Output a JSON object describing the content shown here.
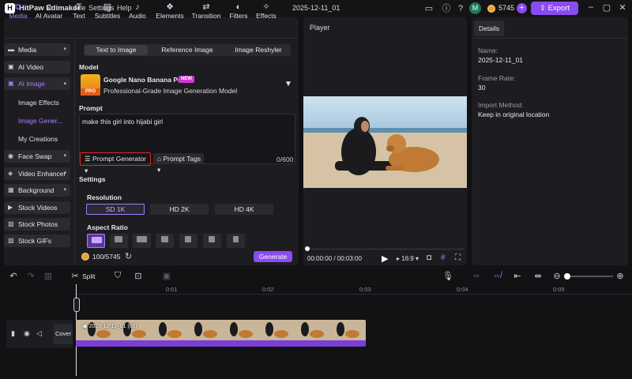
{
  "titlebar": {
    "app_name": "HitPaw Edimakor",
    "menu": [
      "File",
      "Settings",
      "Help"
    ],
    "project_name": "2025-12-11_01",
    "avatar_letter": "M",
    "credits": "5745",
    "export_label": "Export"
  },
  "top_tabs": [
    {
      "label": "Media",
      "icon": "media-icon"
    },
    {
      "label": "AI Avatar",
      "icon": "avatar-icon"
    },
    {
      "label": "Text",
      "icon": "text-icon"
    },
    {
      "label": "Subtitles",
      "icon": "subtitles-icon"
    },
    {
      "label": "Audio",
      "icon": "music-icon"
    },
    {
      "label": "Elements",
      "icon": "elements-icon"
    },
    {
      "label": "Transition",
      "icon": "transition-icon"
    },
    {
      "label": "Filters",
      "icon": "filter-icon"
    },
    {
      "label": "Effects",
      "icon": "effects-icon"
    }
  ],
  "sidebar": {
    "items": [
      {
        "label": "Media",
        "icon": "folder-icon"
      },
      {
        "label": "AI Video",
        "icon": "ai-video-icon"
      },
      {
        "label": "AI Image",
        "icon": "ai-image-icon"
      },
      {
        "label": "Face Swap",
        "icon": "face-swap-icon"
      },
      {
        "label": "Video Enhancer",
        "icon": "enhancer-icon"
      },
      {
        "label": "Background",
        "icon": "background-icon"
      },
      {
        "label": "Stock Videos",
        "icon": "stock-video-icon"
      },
      {
        "label": "Stock Photos",
        "icon": "stock-photo-icon"
      },
      {
        "label": "Stock GIFs",
        "icon": "gif-icon"
      }
    ],
    "subitems": [
      "Image Effects",
      "Image Gener...",
      "My Creations"
    ]
  },
  "generator": {
    "modes": [
      "Text to Image",
      "Reference Image",
      "Image Reshyler"
    ],
    "model_label": "Model",
    "model_name": "Google Nano Banana Pro",
    "model_badge": "NEW",
    "model_desc": "Professional-Grade Image Generation Model",
    "model_thumb_text": "PRO",
    "prompt_label": "Prompt",
    "prompt_value": "make this girl into hijabi girl",
    "prompt_generator": "Prompt Generator",
    "prompt_tags": "Prompt Tags",
    "char_count": "0/600",
    "settings_label": "Settings",
    "resolution_label": "Resolution",
    "resolutions": [
      "SD 1K",
      "HD 2K",
      "HD 4K"
    ],
    "aspect_label": "Aspect Ratio",
    "credits_cost": "100/5745",
    "generate_label": "Generate"
  },
  "player": {
    "title": "Player",
    "time": "00:00:00 / 00:03:00",
    "ratio": "16:9"
  },
  "details": {
    "tab": "Details",
    "name_label": "Name:",
    "name_value": "2025-12-11_01",
    "fps_label": "Frame Rate:",
    "fps_value": "30",
    "import_label": "Import Method:",
    "import_value": "Keep in original location"
  },
  "timeline": {
    "split_label": "Split",
    "ruler": [
      "0:01",
      "0:02",
      "0:03",
      "0:04",
      "0:05"
    ],
    "cover_label": "Cover",
    "clip_label": "2025-12-11_01 (0s)"
  },
  "colors": {
    "accent": "#8b4bf2",
    "accent_light": "#a77bff",
    "highlight": "#e02828"
  }
}
